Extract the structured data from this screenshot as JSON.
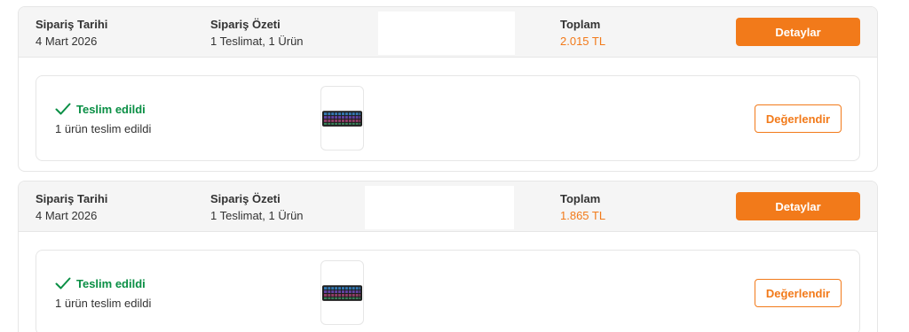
{
  "orders": [
    {
      "date_label": "Sipariş Tarihi",
      "date_value": "4 Mart 2026",
      "summary_label": "Sipariş Özeti",
      "summary_value": "1 Teslimat, 1 Ürün",
      "total_label": "Toplam",
      "total_value": "2.015 TL",
      "details_button": "Detaylar",
      "status": "Teslim edildi",
      "status_sub": "1 ürün teslim edildi",
      "product_icon": "keyboard-icon",
      "review_button": "Değerlendir"
    },
    {
      "date_label": "Sipariş Tarihi",
      "date_value": "4 Mart 2026",
      "summary_label": "Sipariş Özeti",
      "summary_value": "1 Teslimat, 1 Ürün",
      "total_label": "Toplam",
      "total_value": "1.865 TL",
      "details_button": "Detaylar",
      "status": "Teslim edildi",
      "status_sub": "1 ürün teslim edildi",
      "product_icon": "keyboard-icon",
      "review_button": "Değerlendir"
    }
  ],
  "colors": {
    "accent": "#f27a1a",
    "success": "#0a8f45",
    "header_bg": "#f5f5f5",
    "border": "#e6e6e6"
  }
}
